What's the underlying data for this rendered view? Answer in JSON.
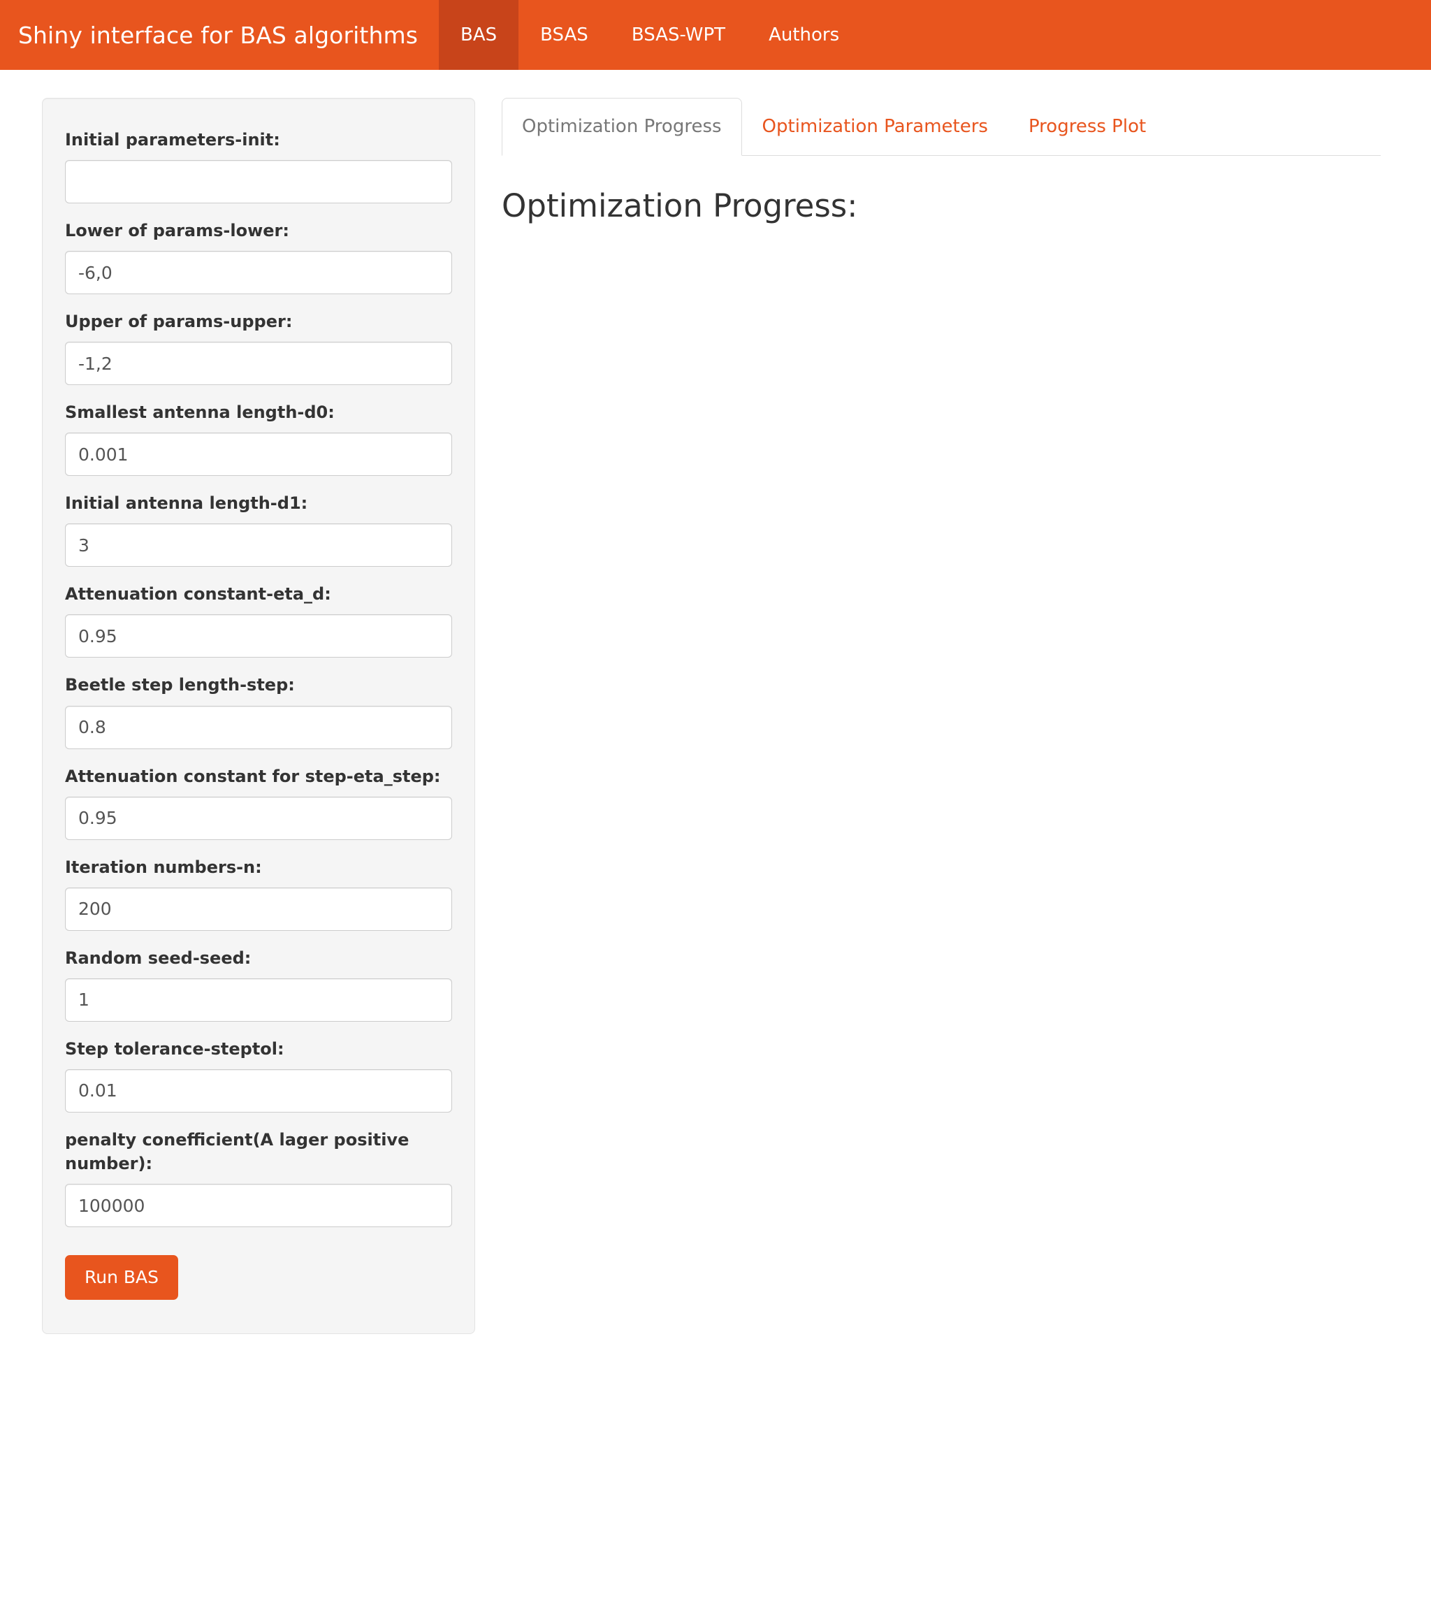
{
  "navbar": {
    "brand": "Shiny interface for BAS algorithms",
    "brand_color": "#E8551E",
    "active_color": "#C8441A",
    "items": [
      {
        "label": "BAS",
        "active": true
      },
      {
        "label": "BSAS",
        "active": false
      },
      {
        "label": "BSAS-WPT",
        "active": false
      },
      {
        "label": "Authors",
        "active": false
      }
    ]
  },
  "sidebar": {
    "fields": [
      {
        "label": "Initial parameters-init:",
        "value": "",
        "name": "init"
      },
      {
        "label": "Lower of params-lower:",
        "value": "-6,0",
        "name": "lower"
      },
      {
        "label": "Upper of params-upper:",
        "value": "-1,2",
        "name": "upper"
      },
      {
        "label": "Smallest antenna length-d0:",
        "value": "0.001",
        "name": "d0"
      },
      {
        "label": "Initial antenna length-d1:",
        "value": "3",
        "name": "d1"
      },
      {
        "label": "Attenuation constant-eta_d:",
        "value": "0.95",
        "name": "eta-d"
      },
      {
        "label": "Beetle step length-step:",
        "value": "0.8",
        "name": "step"
      },
      {
        "label": "Attenuation constant for step-eta_step:",
        "value": "0.95",
        "name": "eta-step"
      },
      {
        "label": "Iteration numbers-n:",
        "value": "200",
        "name": "n"
      },
      {
        "label": "Random seed-seed:",
        "value": "1",
        "name": "seed"
      },
      {
        "label": "Step tolerance-steptol:",
        "value": "0.01",
        "name": "steptol"
      },
      {
        "label": "penalty conefficient(A lager positive number):",
        "value": "100000",
        "name": "penalty"
      }
    ],
    "run_button": "Run BAS"
  },
  "main": {
    "tabs": [
      {
        "label": "Optimization Progress",
        "active": true
      },
      {
        "label": "Optimization Parameters",
        "active": false
      },
      {
        "label": "Progress Plot",
        "active": false
      }
    ],
    "panel_title": "Optimization Progress:",
    "panel_content": ""
  }
}
